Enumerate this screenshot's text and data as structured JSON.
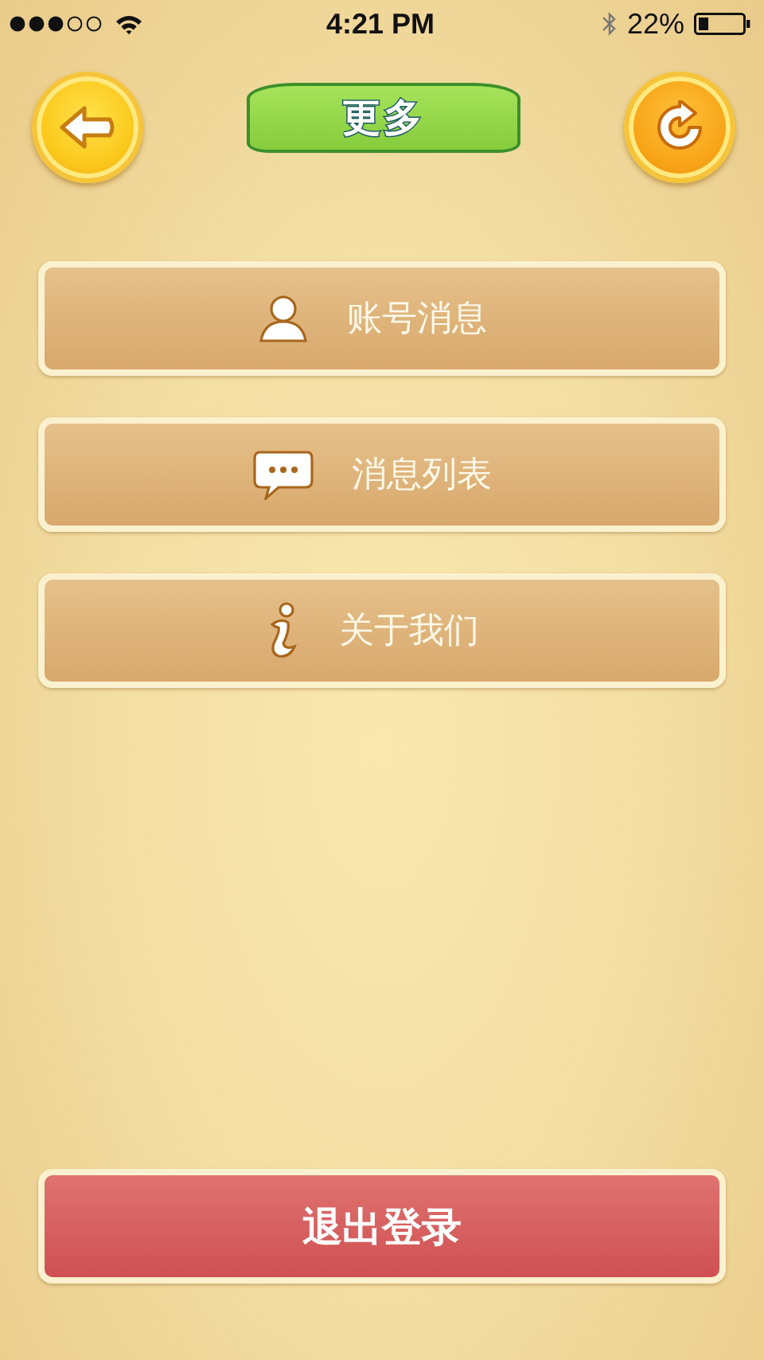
{
  "status_bar": {
    "time": "4:21 PM",
    "battery": "22%"
  },
  "header": {
    "title": "更多"
  },
  "menu": [
    {
      "kind": "account",
      "label": "账号消息"
    },
    {
      "kind": "messages",
      "label": "消息列表"
    },
    {
      "kind": "about",
      "label": "关于我们"
    }
  ],
  "logout": {
    "label": "退出登录"
  }
}
